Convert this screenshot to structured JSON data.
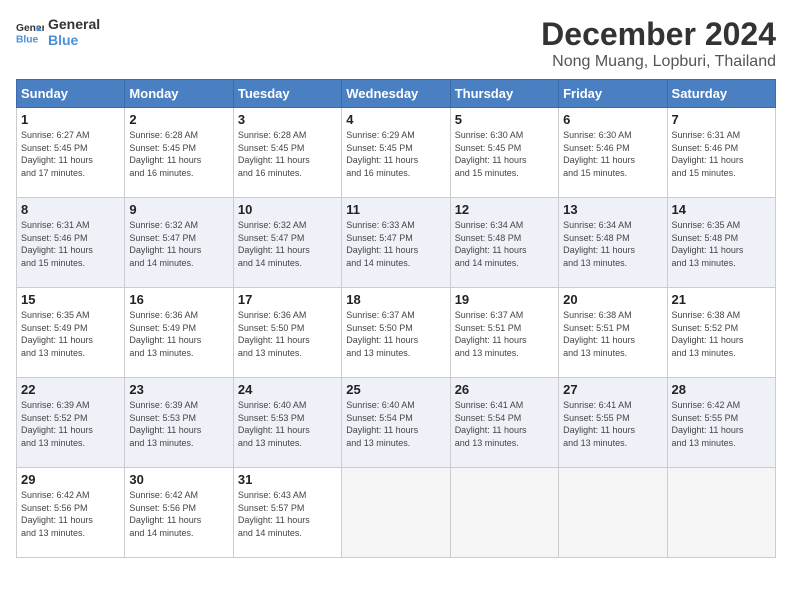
{
  "logo": {
    "line1": "General",
    "line2": "Blue"
  },
  "title": "December 2024",
  "location": "Nong Muang, Lopburi, Thailand",
  "headers": [
    "Sunday",
    "Monday",
    "Tuesday",
    "Wednesday",
    "Thursday",
    "Friday",
    "Saturday"
  ],
  "weeks": [
    [
      {
        "day": "1",
        "info": "Sunrise: 6:27 AM\nSunset: 5:45 PM\nDaylight: 11 hours\nand 17 minutes."
      },
      {
        "day": "2",
        "info": "Sunrise: 6:28 AM\nSunset: 5:45 PM\nDaylight: 11 hours\nand 16 minutes."
      },
      {
        "day": "3",
        "info": "Sunrise: 6:28 AM\nSunset: 5:45 PM\nDaylight: 11 hours\nand 16 minutes."
      },
      {
        "day": "4",
        "info": "Sunrise: 6:29 AM\nSunset: 5:45 PM\nDaylight: 11 hours\nand 16 minutes."
      },
      {
        "day": "5",
        "info": "Sunrise: 6:30 AM\nSunset: 5:45 PM\nDaylight: 11 hours\nand 15 minutes."
      },
      {
        "day": "6",
        "info": "Sunrise: 6:30 AM\nSunset: 5:46 PM\nDaylight: 11 hours\nand 15 minutes."
      },
      {
        "day": "7",
        "info": "Sunrise: 6:31 AM\nSunset: 5:46 PM\nDaylight: 11 hours\nand 15 minutes."
      }
    ],
    [
      {
        "day": "8",
        "info": "Sunrise: 6:31 AM\nSunset: 5:46 PM\nDaylight: 11 hours\nand 15 minutes."
      },
      {
        "day": "9",
        "info": "Sunrise: 6:32 AM\nSunset: 5:47 PM\nDaylight: 11 hours\nand 14 minutes."
      },
      {
        "day": "10",
        "info": "Sunrise: 6:32 AM\nSunset: 5:47 PM\nDaylight: 11 hours\nand 14 minutes."
      },
      {
        "day": "11",
        "info": "Sunrise: 6:33 AM\nSunset: 5:47 PM\nDaylight: 11 hours\nand 14 minutes."
      },
      {
        "day": "12",
        "info": "Sunrise: 6:34 AM\nSunset: 5:48 PM\nDaylight: 11 hours\nand 14 minutes."
      },
      {
        "day": "13",
        "info": "Sunrise: 6:34 AM\nSunset: 5:48 PM\nDaylight: 11 hours\nand 13 minutes."
      },
      {
        "day": "14",
        "info": "Sunrise: 6:35 AM\nSunset: 5:48 PM\nDaylight: 11 hours\nand 13 minutes."
      }
    ],
    [
      {
        "day": "15",
        "info": "Sunrise: 6:35 AM\nSunset: 5:49 PM\nDaylight: 11 hours\nand 13 minutes."
      },
      {
        "day": "16",
        "info": "Sunrise: 6:36 AM\nSunset: 5:49 PM\nDaylight: 11 hours\nand 13 minutes."
      },
      {
        "day": "17",
        "info": "Sunrise: 6:36 AM\nSunset: 5:50 PM\nDaylight: 11 hours\nand 13 minutes."
      },
      {
        "day": "18",
        "info": "Sunrise: 6:37 AM\nSunset: 5:50 PM\nDaylight: 11 hours\nand 13 minutes."
      },
      {
        "day": "19",
        "info": "Sunrise: 6:37 AM\nSunset: 5:51 PM\nDaylight: 11 hours\nand 13 minutes."
      },
      {
        "day": "20",
        "info": "Sunrise: 6:38 AM\nSunset: 5:51 PM\nDaylight: 11 hours\nand 13 minutes."
      },
      {
        "day": "21",
        "info": "Sunrise: 6:38 AM\nSunset: 5:52 PM\nDaylight: 11 hours\nand 13 minutes."
      }
    ],
    [
      {
        "day": "22",
        "info": "Sunrise: 6:39 AM\nSunset: 5:52 PM\nDaylight: 11 hours\nand 13 minutes."
      },
      {
        "day": "23",
        "info": "Sunrise: 6:39 AM\nSunset: 5:53 PM\nDaylight: 11 hours\nand 13 minutes."
      },
      {
        "day": "24",
        "info": "Sunrise: 6:40 AM\nSunset: 5:53 PM\nDaylight: 11 hours\nand 13 minutes."
      },
      {
        "day": "25",
        "info": "Sunrise: 6:40 AM\nSunset: 5:54 PM\nDaylight: 11 hours\nand 13 minutes."
      },
      {
        "day": "26",
        "info": "Sunrise: 6:41 AM\nSunset: 5:54 PM\nDaylight: 11 hours\nand 13 minutes."
      },
      {
        "day": "27",
        "info": "Sunrise: 6:41 AM\nSunset: 5:55 PM\nDaylight: 11 hours\nand 13 minutes."
      },
      {
        "day": "28",
        "info": "Sunrise: 6:42 AM\nSunset: 5:55 PM\nDaylight: 11 hours\nand 13 minutes."
      }
    ],
    [
      {
        "day": "29",
        "info": "Sunrise: 6:42 AM\nSunset: 5:56 PM\nDaylight: 11 hours\nand 13 minutes."
      },
      {
        "day": "30",
        "info": "Sunrise: 6:42 AM\nSunset: 5:56 PM\nDaylight: 11 hours\nand 14 minutes."
      },
      {
        "day": "31",
        "info": "Sunrise: 6:43 AM\nSunset: 5:57 PM\nDaylight: 11 hours\nand 14 minutes."
      },
      {
        "day": "",
        "info": ""
      },
      {
        "day": "",
        "info": ""
      },
      {
        "day": "",
        "info": ""
      },
      {
        "day": "",
        "info": ""
      }
    ]
  ]
}
